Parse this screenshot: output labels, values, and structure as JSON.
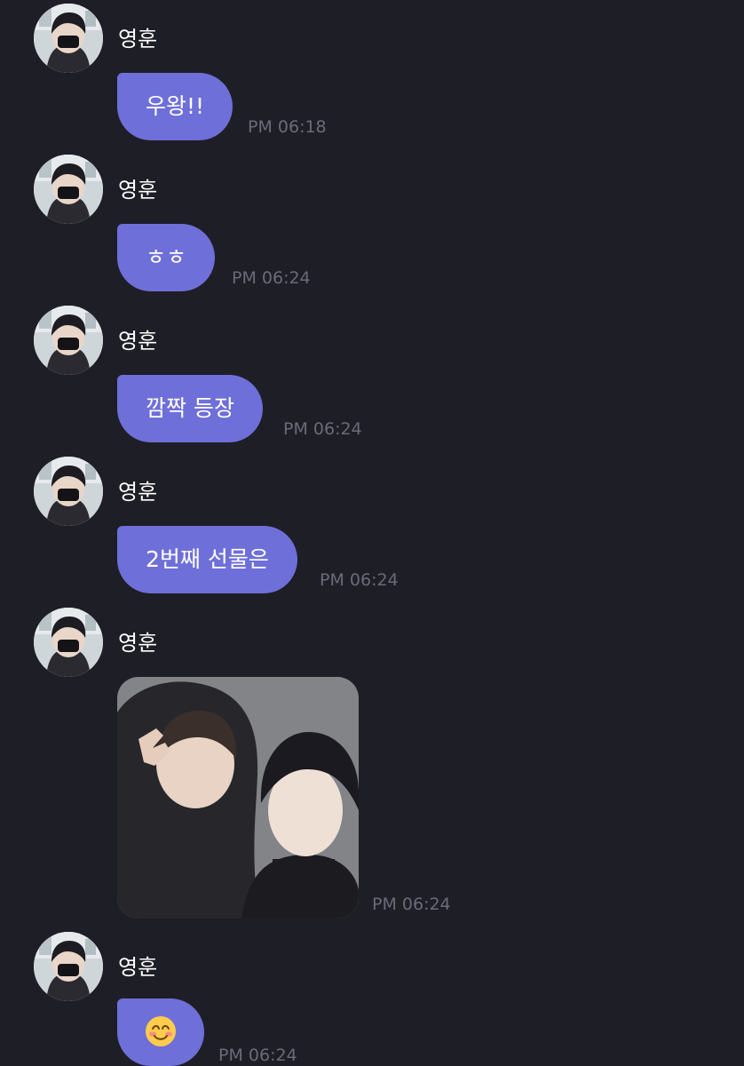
{
  "messages": [
    {
      "sender": "영훈",
      "text": "우왕!!",
      "time": "PM 06:18"
    },
    {
      "sender": "영훈",
      "text": "ㅎㅎ",
      "time": "PM 06:24"
    },
    {
      "sender": "영훈",
      "text": "깜짝 등장",
      "time": "PM 06:24"
    },
    {
      "sender": "영훈",
      "text": "2번째 선물은",
      "time": "PM 06:24"
    },
    {
      "sender": "영훈",
      "image": "selfie-photo",
      "time": "PM 06:24"
    },
    {
      "sender": "영훈",
      "emoji": "smiling-face-emoji",
      "time": "PM 06:24"
    }
  ],
  "colors": {
    "background": "#1e1e26",
    "bubble": "#6f6fd9",
    "text": "#ffffff",
    "timestamp": "#6b6b78"
  }
}
